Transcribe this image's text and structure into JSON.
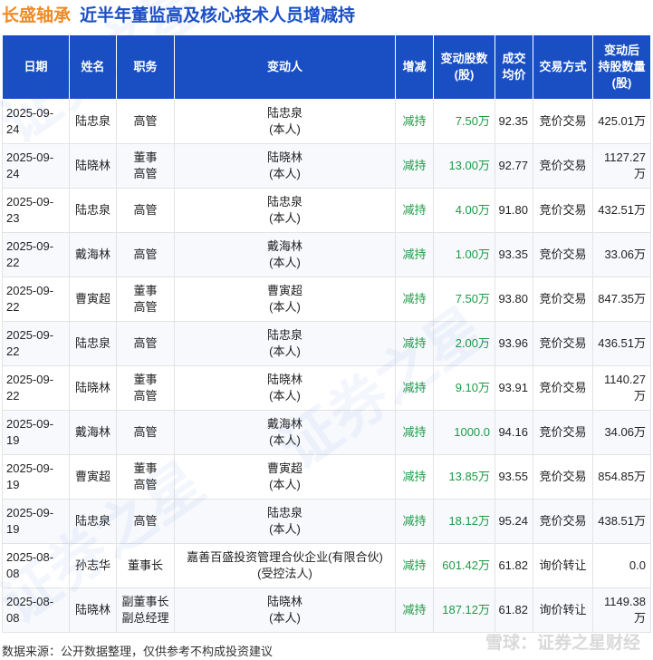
{
  "header": {
    "company": "长盛轴承",
    "headline": "近半年董监高及核心技术人员增减持"
  },
  "table": {
    "columns": [
      "日期",
      "姓名",
      "职务",
      "变动人",
      "增减",
      "变动股数\n(股)",
      "成交\n均价",
      "交易方式",
      "变动后\n持股数量\n(股)"
    ],
    "rows": [
      {
        "date": "2025-09-24",
        "name": "陆忠泉",
        "position": "高管",
        "person": "陆忠泉\n(本人)",
        "direction": "减持",
        "shares": "7.50万",
        "price": "92.35",
        "method": "竞价交易",
        "holding": "425.01万"
      },
      {
        "date": "2025-09-24",
        "name": "陆晓林",
        "position": "董事\n高管",
        "person": "陆晓林\n(本人)",
        "direction": "减持",
        "shares": "13.00万",
        "price": "92.77",
        "method": "竞价交易",
        "holding": "1127.27万"
      },
      {
        "date": "2025-09-23",
        "name": "陆忠泉",
        "position": "高管",
        "person": "陆忠泉\n(本人)",
        "direction": "减持",
        "shares": "4.00万",
        "price": "91.80",
        "method": "竞价交易",
        "holding": "432.51万"
      },
      {
        "date": "2025-09-22",
        "name": "戴海林",
        "position": "高管",
        "person": "戴海林\n(本人)",
        "direction": "减持",
        "shares": "1.00万",
        "price": "93.35",
        "method": "竞价交易",
        "holding": "33.06万"
      },
      {
        "date": "2025-09-22",
        "name": "曹寅超",
        "position": "董事\n高管",
        "person": "曹寅超\n(本人)",
        "direction": "减持",
        "shares": "7.50万",
        "price": "93.80",
        "method": "竞价交易",
        "holding": "847.35万"
      },
      {
        "date": "2025-09-22",
        "name": "陆忠泉",
        "position": "高管",
        "person": "陆忠泉\n(本人)",
        "direction": "减持",
        "shares": "2.00万",
        "price": "93.96",
        "method": "竞价交易",
        "holding": "436.51万"
      },
      {
        "date": "2025-09-22",
        "name": "陆晓林",
        "position": "董事\n高管",
        "person": "陆晓林\n(本人)",
        "direction": "减持",
        "shares": "9.10万",
        "price": "93.91",
        "method": "竞价交易",
        "holding": "1140.27万"
      },
      {
        "date": "2025-09-19",
        "name": "戴海林",
        "position": "高管",
        "person": "戴海林\n(本人)",
        "direction": "减持",
        "shares": "1000.0",
        "price": "94.16",
        "method": "竞价交易",
        "holding": "34.06万"
      },
      {
        "date": "2025-09-19",
        "name": "曹寅超",
        "position": "董事\n高管",
        "person": "曹寅超\n(本人)",
        "direction": "减持",
        "shares": "13.85万",
        "price": "93.55",
        "method": "竞价交易",
        "holding": "854.85万"
      },
      {
        "date": "2025-09-19",
        "name": "陆忠泉",
        "position": "高管",
        "person": "陆忠泉\n(本人)",
        "direction": "减持",
        "shares": "18.12万",
        "price": "95.24",
        "method": "竞价交易",
        "holding": "438.51万"
      },
      {
        "date": "2025-08-08",
        "name": "孙志华",
        "position": "董事长",
        "person": "嘉善百盛投资管理合伙企业(有限合伙)\n(受控法人)",
        "direction": "减持",
        "shares": "601.42万",
        "price": "61.82",
        "method": "询价转让",
        "holding": "0.0"
      },
      {
        "date": "2025-08-08",
        "name": "陆晓林",
        "position": "副董事长\n副总经理",
        "person": "陆晓林\n(本人)",
        "direction": "减持",
        "shares": "187.12万",
        "price": "61.82",
        "method": "询价转让",
        "holding": "1149.38万"
      }
    ]
  },
  "footer": {
    "source": "数据来源：公开数据整理，仅供参考不构成投资建议",
    "brand": "雪球：证券之星财经"
  },
  "watermark": {
    "text": "证券之星"
  },
  "colors": {
    "header_bg": "#1a4fc4",
    "company": "#f08a24",
    "headline": "#1a4fc4",
    "reduce_green": "#1d9a45"
  }
}
